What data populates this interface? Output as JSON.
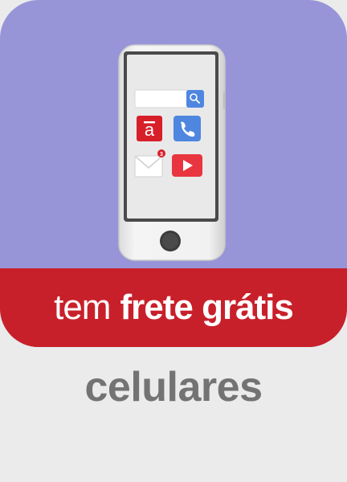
{
  "banner": {
    "text_regular": "tem",
    "text_bold": "frete grátis"
  },
  "category": {
    "label": "celulares"
  },
  "phone": {
    "app_logo_letter": "a",
    "notification_count": "3",
    "icons": [
      "search-icon",
      "app-logo-icon",
      "phone-call-icon",
      "mail-icon",
      "play-video-icon"
    ]
  },
  "colors": {
    "card_background": "#9795d8",
    "banner_red": "#c8202a",
    "label_gray": "#737373",
    "page_background": "#ebebeb"
  }
}
